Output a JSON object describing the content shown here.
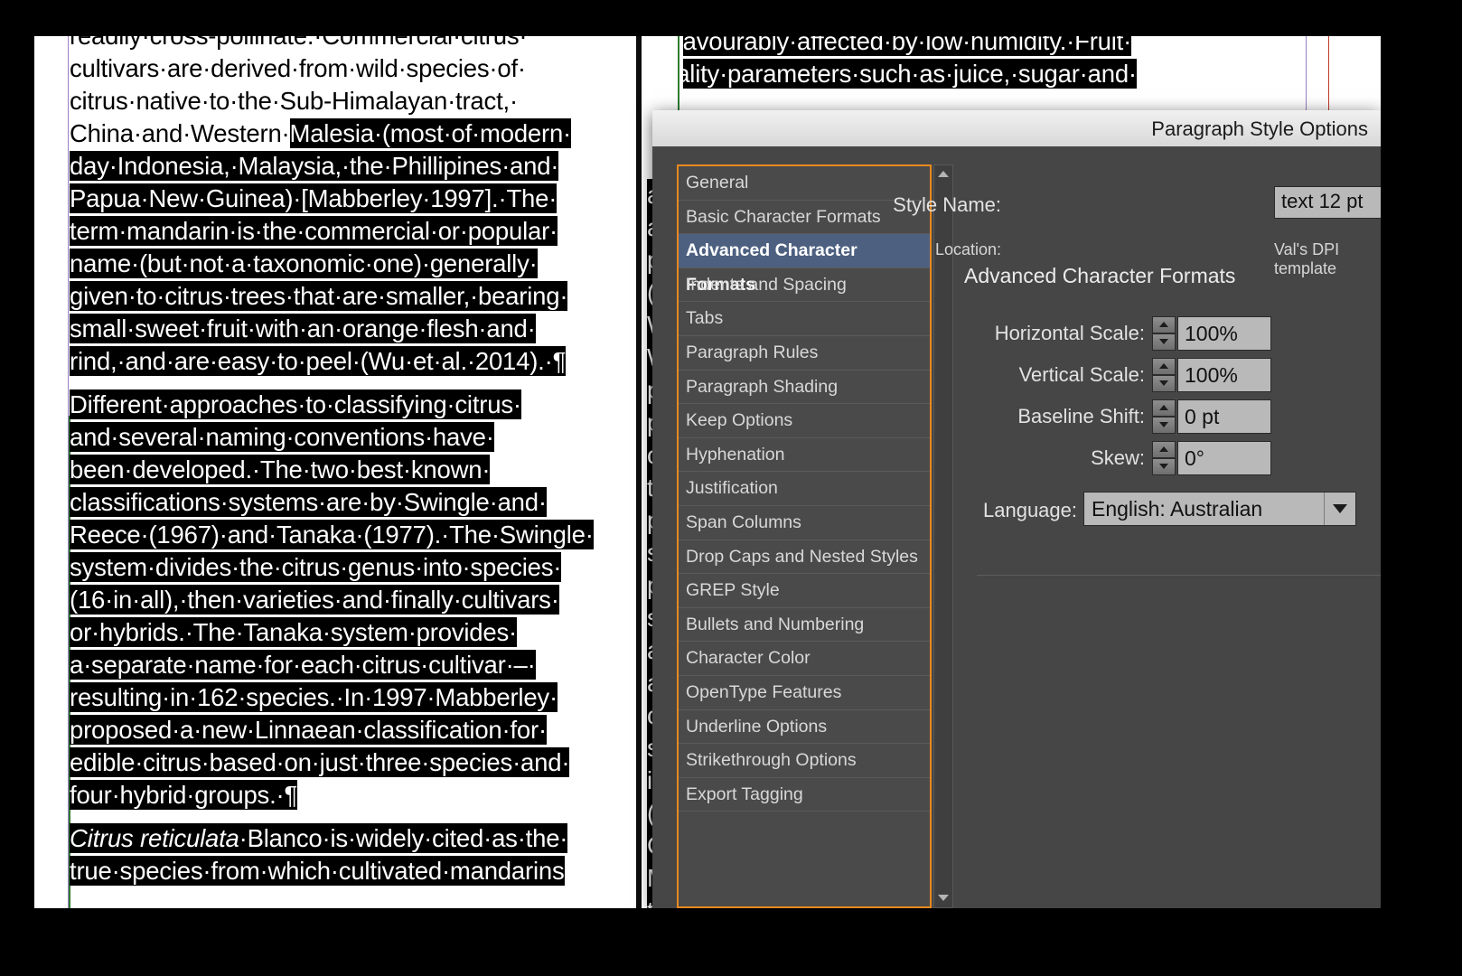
{
  "document": {
    "left_column": {
      "paragraph_1_lines": [
        "readily·cross-pollinate.·Commercial·citrus·",
        "cultivars·are·derived·from·wild·species·of·",
        "citrus·native·to·the·Sub-Himalayan·tract,·",
        "China·and·Western·Malesia·(most·of·modern·",
        "day·Indonesia,·Malaysia,·the·Phillipines·and·",
        "Papua·New·Guinea)·[Mabberley·1997].·The·",
        "term·mandarin·is·the·commercial·or·popular·",
        "name·(but·not·a·taxonomic·one)·generally·",
        "given·to·citrus·trees·that·are·smaller,·bearing·",
        "small·sweet·fruit·with·an·orange·flesh·and·",
        "rind,·and·are·easy·to·peel·(Wu·et·al.·2014).·¶"
      ],
      "paragraph_2_lines": [
        "Different·approaches·to·classifying·citrus·",
        "and·several·naming·conventions·have·",
        "been·developed.·The·two·best·known·",
        "classifications·systems·are·by·Swingle·and·",
        "Reece·(1967)·and·Tanaka·(1977).·The·Swingle·",
        "system·divides·the·citrus·genus·into·species·",
        "(16·in·all),·then·varieties·and·finally·cultivars·",
        "or·hybrids.·The·Tanaka·system·provides·",
        "a·separate·name·for·each·citrus·cultivar·–·",
        "resulting·in·162·species.·In·1997·Mabberley·",
        "proposed·a·new·Linnaean·classification·for·",
        "edible·citrus·based·on·just·three·species·and·",
        "four·hybrid·groups.·¶"
      ],
      "paragraph_3_lines": [
        "Citrus reticulata·Blanco·is·widely·cited·as·the·",
        "true·species·from·which·cultivated·mandarins"
      ],
      "paragraph_3_italic_prefix": "Citrus reticulata"
    },
    "right_column": {
      "visible_lines": [
        "unfavourably·affected·by·low·humidity.·Fruit·",
        "quality·parameters·such·as·juice,·sugar·and·"
      ],
      "clipped_line_fragments": [
        "a",
        "a",
        "p",
        "(",
        "W",
        "W",
        "p",
        "p",
        "c",
        "t",
        "p",
        "s",
        "p",
        "s",
        "a",
        "a",
        "c",
        "s",
        "i",
        "(",
        "C",
        "M",
        "t",
        "S"
      ]
    }
  },
  "dialog": {
    "title": "Paragraph Style Options",
    "style_name_label": "Style Name:",
    "style_name_value": "text 12 pt",
    "location_label": "Location:",
    "location_value": "Val's DPI template",
    "section_title": "Advanced Character Formats",
    "categories": [
      {
        "label": "General",
        "selected": false
      },
      {
        "label": "Basic Character Formats",
        "selected": false
      },
      {
        "label": "Advanced Character Formats",
        "selected": true
      },
      {
        "label": "Indents and Spacing",
        "selected": false
      },
      {
        "label": "Tabs",
        "selected": false
      },
      {
        "label": "Paragraph Rules",
        "selected": false
      },
      {
        "label": "Paragraph Shading",
        "selected": false
      },
      {
        "label": "Keep Options",
        "selected": false
      },
      {
        "label": "Hyphenation",
        "selected": false
      },
      {
        "label": "Justification",
        "selected": false
      },
      {
        "label": "Span Columns",
        "selected": false
      },
      {
        "label": "Drop Caps and Nested Styles",
        "selected": false
      },
      {
        "label": "GREP Style",
        "selected": false
      },
      {
        "label": "Bullets and Numbering",
        "selected": false
      },
      {
        "label": "Character Color",
        "selected": false
      },
      {
        "label": "OpenType Features",
        "selected": false
      },
      {
        "label": "Underline Options",
        "selected": false
      },
      {
        "label": "Strikethrough Options",
        "selected": false
      },
      {
        "label": "Export Tagging",
        "selected": false
      }
    ],
    "fields": [
      {
        "label": "Horizontal Scale:",
        "value": "100%"
      },
      {
        "label": "Vertical Scale:",
        "value": "100%"
      },
      {
        "label": "Baseline Shift:",
        "value": "0 pt"
      },
      {
        "label": "Skew:",
        "value": "0°"
      }
    ],
    "language_label": "Language:",
    "language_value": "English: Australian"
  },
  "colors": {
    "dialog_bg": "#464646",
    "titlebar": "#e8e8e8",
    "list_focus_border": "#e8891f",
    "selection_blue": "#4d6080",
    "field_bg": "#b9b9b9",
    "text_light": "#e2e2e2",
    "guide_purple": "#9a7fc4",
    "guide_green": "#2f7d32",
    "highlight_black": "#000000"
  }
}
